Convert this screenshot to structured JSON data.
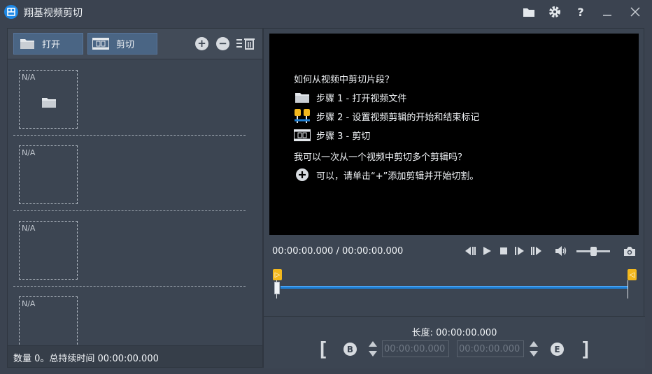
{
  "app": {
    "title": "翔基视频剪切",
    "icon": "app-logo-icon"
  },
  "titlebar": {
    "buttons": [
      "folder-icon",
      "gear-icon",
      "help-icon",
      "minimize-icon",
      "close-icon"
    ],
    "help_glyph": "?"
  },
  "toolbar": {
    "open_label": "打开",
    "cut_label": "剪切"
  },
  "clips": [
    {
      "thumb_label": "N/A",
      "has_folder": true
    },
    {
      "thumb_label": "N/A",
      "has_folder": false
    },
    {
      "thumb_label": "N/A",
      "has_folder": false
    },
    {
      "thumb_label": "N/A",
      "has_folder": false
    }
  ],
  "status": {
    "text": "数量 0。总持续时间 00:00:00.000"
  },
  "help": {
    "q1": "如何从视频中剪切片段？",
    "step1": "步骤 1 - 打开视频文件",
    "step2": "步骤 2 - 设置视频剪辑的开始和结束标记",
    "step3": "步骤 3 - 剪切",
    "q2": "我可以一次从一个视频中剪切多个剪辑吗？",
    "a2": "可以，请单击“+”添加剪辑并开始切割。"
  },
  "player": {
    "timecode": "00:00:00.000 / 00:00:00.000"
  },
  "markers": {
    "start_glyph": "▷",
    "end_glyph": "◁"
  },
  "trim": {
    "length_label": "长度: 00:00:00.000",
    "begin_letter": "B",
    "end_letter": "E",
    "start_value": "00:00:00.000",
    "end_value": "00:00:00.000"
  },
  "colors": {
    "accent": "#1f7fd3",
    "marker": "#f3b81d",
    "button": "#4a6584"
  }
}
